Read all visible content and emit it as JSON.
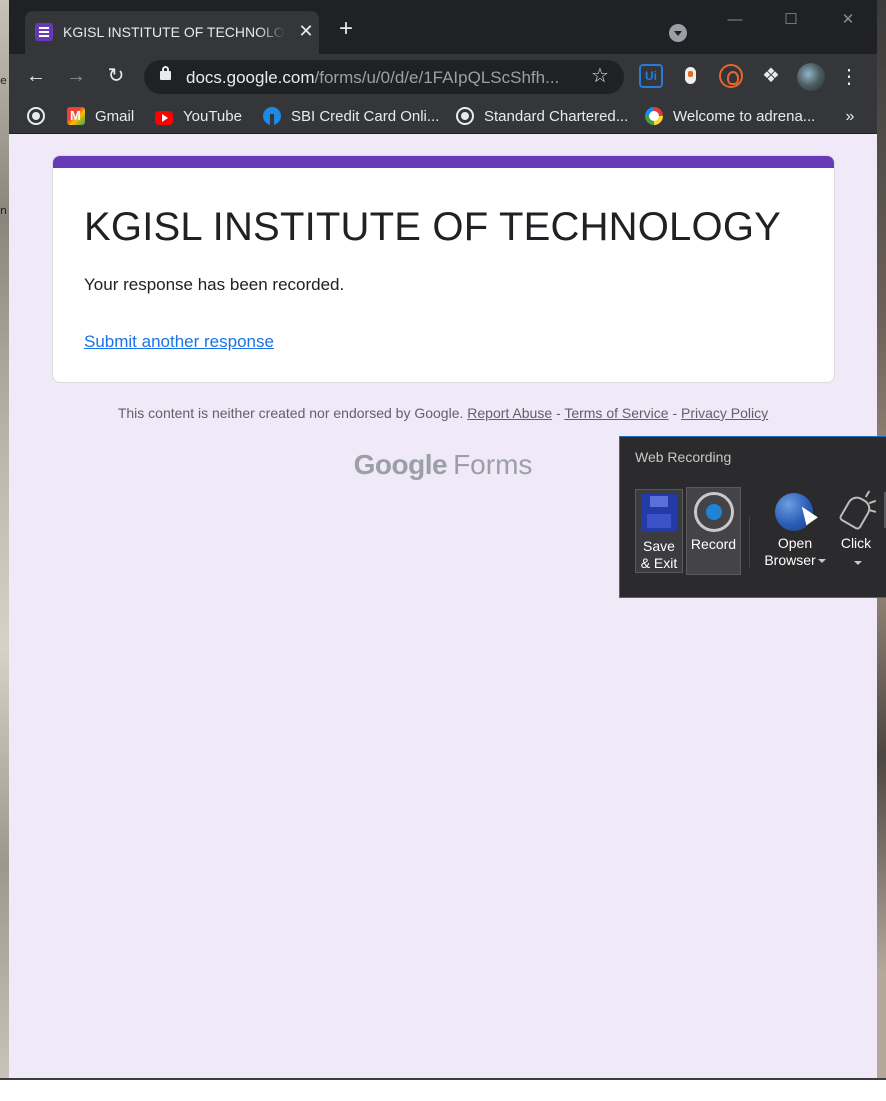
{
  "browser": {
    "tab_title": "KGISL INSTITUTE OF TECHNOLOGY",
    "tab_close": "✕",
    "new_tab": "+",
    "window_controls": {
      "minimize": "—",
      "maximize": "☐",
      "close": "✕"
    },
    "url_domain": "docs.google.com",
    "url_path": "/forms/u/0/d/e/1FAIpQLScShfh...",
    "bookmarks": [
      {
        "label": "",
        "icon": "globe-icon"
      },
      {
        "label": "Gmail",
        "icon": "gmail-icon"
      },
      {
        "label": "YouTube",
        "icon": "youtube-icon"
      },
      {
        "label": "SBI Credit Card Onli...",
        "icon": "sbi-icon"
      },
      {
        "label": "Standard Chartered...",
        "icon": "globe-icon"
      },
      {
        "label": "Welcome to adrena...",
        "icon": "adrena-icon"
      }
    ],
    "bookmarks_more": "»",
    "extensions": {
      "ui_label": "Ui"
    }
  },
  "form": {
    "title": "KGISL INSTITUTE OF TECHNOLOGY",
    "confirmation": "Your response has been recorded.",
    "submit_another": "Submit another response",
    "accent_color": "#673ab7"
  },
  "footer": {
    "disclaimer": "This content is neither created nor endorsed by Google.",
    "report_abuse": "Report Abuse",
    "sep1": "-",
    "terms": "Terms of Service",
    "sep2": "-",
    "privacy": "Privacy Policy",
    "brand_google": "Google",
    "brand_forms": "Forms"
  },
  "recorder": {
    "title": "Web Recording",
    "save_exit_line1": "Save",
    "save_exit_line2": "& Exit",
    "record": "Record",
    "open_browser_line1": "Open",
    "open_browser_line2": "Browser",
    "click": "Click"
  },
  "desktop_fragments": [
    "e",
    "n"
  ]
}
